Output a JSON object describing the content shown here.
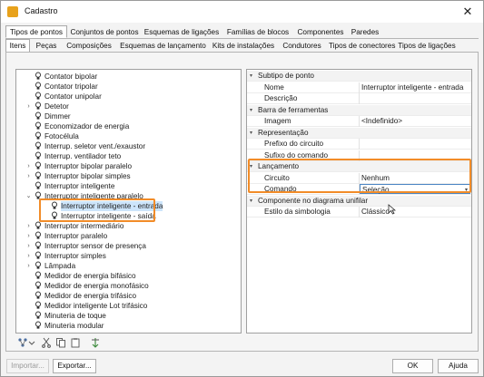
{
  "window": {
    "title": "Cadastro",
    "close_symbol": "✕"
  },
  "tabs_primary": [
    {
      "label": "Tipos de pontos",
      "active": true
    },
    {
      "label": "Conjuntos de pontos"
    },
    {
      "label": "Esquemas de ligações"
    },
    {
      "label": "Famílias de blocos"
    },
    {
      "label": "Componentes"
    },
    {
      "label": "Paredes"
    }
  ],
  "tabs_secondary": [
    {
      "label": "Itens"
    },
    {
      "label": "Peças"
    },
    {
      "label": "Composições"
    },
    {
      "label": "Esquemas de lançamento"
    },
    {
      "label": "Kits de instalações"
    },
    {
      "label": "Condutores"
    },
    {
      "label": "Tipos de conectores"
    },
    {
      "label": "Tipos de ligações"
    }
  ],
  "tree": {
    "items": [
      {
        "label": "Contator bipolar",
        "expander": ""
      },
      {
        "label": "Contator tripolar",
        "expander": ""
      },
      {
        "label": "Contator unipolar",
        "expander": ""
      },
      {
        "label": "Detetor",
        "expander": "›"
      },
      {
        "label": "Dimmer",
        "expander": ""
      },
      {
        "label": "Economizador de energia",
        "expander": ""
      },
      {
        "label": "Fotocélula",
        "expander": ""
      },
      {
        "label": "Interrup. seletor vent./exaustor",
        "expander": ""
      },
      {
        "label": "Interrup. ventilador teto",
        "expander": ""
      },
      {
        "label": "Interruptor bipolar paralelo",
        "expander": "›"
      },
      {
        "label": "Interruptor bipolar simples",
        "expander": "›"
      },
      {
        "label": "Interruptor inteligente",
        "expander": ""
      },
      {
        "label": "Interruptor inteligente paralelo",
        "expander": "⌄"
      },
      {
        "label": "Interruptor inteligente - entrada",
        "expander": "",
        "child": true,
        "selected": true
      },
      {
        "label": "Interruptor inteligente - saída",
        "expander": "",
        "child": true
      },
      {
        "label": "Interruptor intermediário",
        "expander": "›"
      },
      {
        "label": "Interruptor paralelo",
        "expander": "›"
      },
      {
        "label": "Interruptor sensor de presença",
        "expander": "›"
      },
      {
        "label": "Interruptor simples",
        "expander": "›"
      },
      {
        "label": "Lâmpada",
        "expander": "›"
      },
      {
        "label": "Medidor de energia bifásico",
        "expander": ""
      },
      {
        "label": "Medidor de energia monofásico",
        "expander": ""
      },
      {
        "label": "Medidor de energia trifásico",
        "expander": ""
      },
      {
        "label": "Medidor inteligente Lot trifásico",
        "expander": ""
      },
      {
        "label": "Minuteria de toque",
        "expander": ""
      },
      {
        "label": "Minuteria modular",
        "expander": ""
      }
    ]
  },
  "properties": {
    "rows": [
      {
        "type": "section",
        "name": "Subtipo de ponto"
      },
      {
        "type": "prop",
        "name": "Nome",
        "value": "Interruptor inteligente - entrada"
      },
      {
        "type": "prop",
        "name": "Descrição",
        "value": ""
      },
      {
        "type": "section",
        "name": "Barra de ferramentas"
      },
      {
        "type": "prop",
        "name": "Imagem",
        "value": "<Indefinido>"
      },
      {
        "type": "section",
        "name": "Representação"
      },
      {
        "type": "prop",
        "name": "Prefixo do circuito",
        "value": ""
      },
      {
        "type": "prop",
        "name": "Sufixo do comando",
        "value": ""
      },
      {
        "type": "section",
        "name": "Lançamento"
      },
      {
        "type": "prop",
        "name": "Circuito",
        "value": "Nenhum"
      },
      {
        "type": "dropdown",
        "name": "Comando",
        "value": "Seleção"
      },
      {
        "type": "section",
        "name": "Componente no diagrama unifilar"
      },
      {
        "type": "prop",
        "name": "Estilo da simbologia",
        "value": "Clássico"
      }
    ]
  },
  "toolbar_icons": [
    "tree-add-icon",
    "tree-dropdown-icon",
    "cut-icon",
    "copy-icon",
    "paste-icon",
    "sort-icon"
  ],
  "buttons": {
    "importar": "Importar...",
    "exportar": "Exportar...",
    "ok": "OK",
    "ajuda": "Ajuda"
  },
  "colors": {
    "highlight": "#f28c28",
    "selection": "#cde5fb",
    "dropdown_border": "#4b86c4"
  }
}
